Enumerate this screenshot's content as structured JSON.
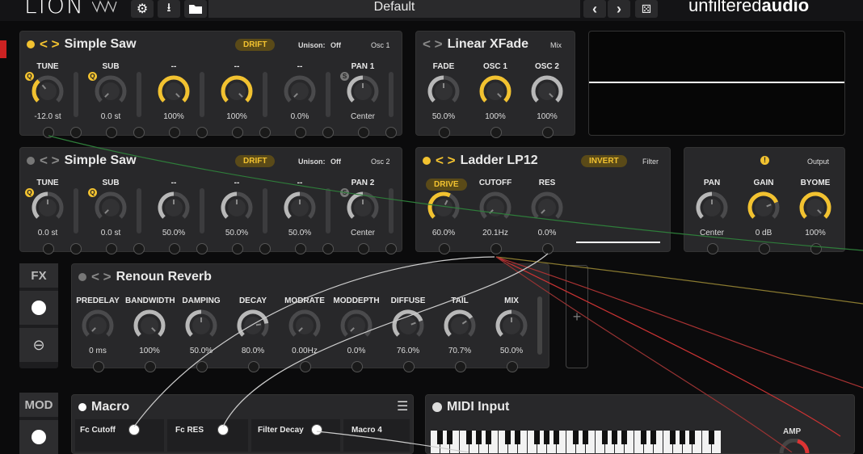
{
  "topbar": {
    "logo": "LION",
    "preset_name": "Default",
    "brand_light": "unfiltered",
    "brand_bold": "audio",
    "icons": [
      "gear-icon",
      "download-icon",
      "folder-icon",
      "chevron-left-icon",
      "chevron-right-icon",
      "dice-icon"
    ]
  },
  "osc1": {
    "title": "Simple Saw",
    "drift": "DRIFT",
    "unison_label": "Unison:",
    "unison_value": "Off",
    "slot": "Osc 1",
    "knobs": [
      {
        "label": "TUNE",
        "value": "-12.0 st",
        "level": 0.35,
        "active": true
      },
      {
        "label": "SUB",
        "value": "0.0 st",
        "level": 0.0,
        "active": true
      },
      {
        "label": "--",
        "value": "100%",
        "level": 1.0,
        "active": true
      },
      {
        "label": "--",
        "value": "100%",
        "level": 1.0,
        "active": true
      },
      {
        "label": "--",
        "value": "0.0%",
        "level": 0.0,
        "active": true
      },
      {
        "label": "PAN 1",
        "value": "Center",
        "level": 0.5,
        "active": false
      }
    ]
  },
  "osc2": {
    "title": "Simple Saw",
    "drift": "DRIFT",
    "unison_label": "Unison:",
    "unison_value": "Off",
    "slot": "Osc 2",
    "knobs": [
      {
        "label": "TUNE",
        "value": "0.0 st",
        "level": 0.5,
        "active": false
      },
      {
        "label": "SUB",
        "value": "0.0 st",
        "level": 0.0,
        "active": false
      },
      {
        "label": "--",
        "value": "50.0%",
        "level": 0.5,
        "active": false
      },
      {
        "label": "--",
        "value": "50.0%",
        "level": 0.5,
        "active": false
      },
      {
        "label": "--",
        "value": "50.0%",
        "level": 0.5,
        "active": false
      },
      {
        "label": "PAN 2",
        "value": "Center",
        "level": 0.5,
        "active": false
      }
    ]
  },
  "mix": {
    "title": "Linear XFade",
    "slot": "Mix",
    "knobs": [
      {
        "label": "FADE",
        "value": "50.0%",
        "level": 0.5,
        "active": false
      },
      {
        "label": "OSC 1",
        "value": "100%",
        "level": 1.0,
        "active": true
      },
      {
        "label": "OSC 2",
        "value": "100%",
        "level": 1.0,
        "active": false
      }
    ]
  },
  "filter": {
    "title": "Ladder LP12",
    "invert": "INVERT",
    "slot": "Filter",
    "drive": "DRIVE",
    "knobs": [
      {
        "label": "",
        "value": "60.0%",
        "level": 0.6,
        "active": true
      },
      {
        "label": "CUTOFF",
        "value": "20.1Hz",
        "level": 0.0,
        "active": false
      },
      {
        "label": "RES",
        "value": "0.0%",
        "level": 0.0,
        "active": false
      }
    ]
  },
  "output": {
    "slot": "Output",
    "knobs": [
      {
        "label": "PAN",
        "value": "Center",
        "level": 0.5,
        "active": false
      },
      {
        "label": "GAIN",
        "value": "0 dB",
        "level": 0.75,
        "active": true
      },
      {
        "label": "BYOME",
        "value": "100%",
        "level": 1.0,
        "active": true
      }
    ]
  },
  "fx": {
    "side_label": "FX",
    "title": "Renoun Reverb",
    "knobs": [
      {
        "label": "PREDELAY",
        "value": "0 ms",
        "level": 0.0,
        "active": false
      },
      {
        "label": "BANDWIDTH",
        "value": "100%",
        "level": 1.0,
        "active": false
      },
      {
        "label": "DAMPING",
        "value": "50.0%",
        "level": 0.5,
        "active": false
      },
      {
        "label": "DECAY",
        "value": "80.0%",
        "level": 0.8,
        "active": false
      },
      {
        "label": "MODRATE",
        "value": "0.00Hz",
        "level": 0.0,
        "active": false
      },
      {
        "label": "MODDEPTH",
        "value": "0.0%",
        "level": 0.0,
        "active": false
      },
      {
        "label": "DIFFUSE",
        "value": "76.0%",
        "level": 0.76,
        "active": false
      },
      {
        "label": "TAIL",
        "value": "70.7%",
        "level": 0.707,
        "active": false
      },
      {
        "label": "MIX",
        "value": "50.0%",
        "level": 0.5,
        "active": false
      }
    ],
    "add_symbol": "+"
  },
  "mod": {
    "side_label": "MOD",
    "macro_title": "Macro",
    "macros": [
      "Fc Cutoff",
      "Fc RES",
      "Filter Decay",
      "Macro 4"
    ],
    "midi_title": "MIDI Input",
    "amp_label": "AMP"
  }
}
